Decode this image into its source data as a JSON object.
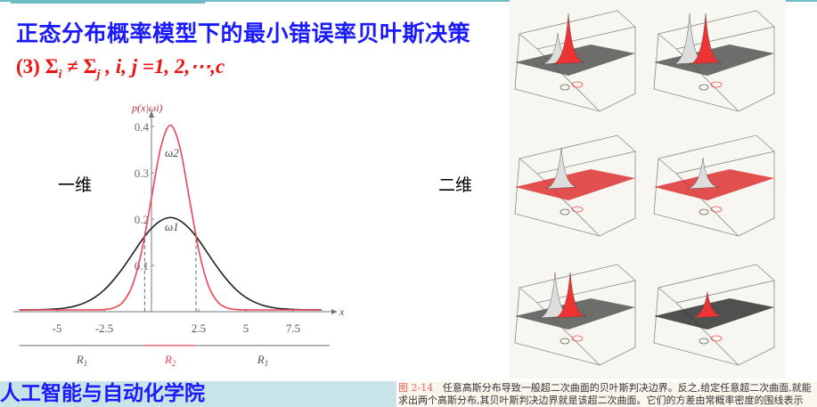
{
  "header": {
    "title": "正态分布概率模型下的最小错误率贝叶斯决策",
    "formula": {
      "prefix": "(3) Σ",
      "sub_i": "i",
      "neq": " ≠ Σ",
      "sub_j": "j",
      "rest": " ,   i, j =1, 2,⋯,c"
    }
  },
  "labels": {
    "one_dim": "一维",
    "two_dim": "二维"
  },
  "chart_data": {
    "type": "line",
    "ylabel": "p(x|ωi)",
    "xlabel": "x",
    "x_ticks": [
      "-5",
      "-2.5",
      "2.5",
      "5",
      "7.5"
    ],
    "x_tick_values": [
      -5,
      -2.5,
      2.5,
      5,
      7.5
    ],
    "y_ticks": [
      "0.1",
      "0.2",
      "0.3",
      "0.4"
    ],
    "y_tick_values": [
      0.1,
      0.2,
      0.3,
      0.4
    ],
    "xlim": [
      -7,
      9.5
    ],
    "ylim": [
      0,
      0.42
    ],
    "grid": false,
    "x": [
      -7,
      -6.5,
      -6,
      -5.5,
      -5,
      -4.5,
      -4,
      -3.5,
      -3,
      -2.5,
      -2,
      -1.5,
      -1,
      -0.5,
      0,
      0.5,
      1,
      1.5,
      2,
      2.5,
      3,
      3.5,
      4,
      4.5,
      5,
      5.5,
      6,
      6.5,
      7,
      7.5,
      8,
      8.5,
      9
    ],
    "series": [
      {
        "name": "ω1",
        "color": "#222222",
        "values": [
          0.0001,
          0.0002,
          0.0004,
          0.001,
          0.0022,
          0.0046,
          0.0088,
          0.016,
          0.027,
          0.0431,
          0.065,
          0.0914,
          0.121,
          0.151,
          0.176,
          0.193,
          0.1995,
          0.193,
          0.176,
          0.151,
          0.121,
          0.0914,
          0.065,
          0.0431,
          0.027,
          0.016,
          0.0088,
          0.0046,
          0.0022,
          0.001,
          0.0004,
          0.0002,
          0.0001
        ]
      },
      {
        "name": "ω2",
        "color": "#ee4455",
        "values": [
          0,
          0,
          0,
          0,
          0,
          0,
          0,
          0,
          0.0001,
          0.0009,
          0.0044,
          0.0175,
          0.054,
          0.13,
          0.242,
          0.352,
          0.399,
          0.352,
          0.242,
          0.13,
          0.054,
          0.0175,
          0.0044,
          0.0009,
          0.0001,
          0,
          0,
          0,
          0,
          0,
          0,
          0,
          0
        ]
      }
    ],
    "decision_boundaries": [
      -0.36,
      2.36
    ],
    "regions": [
      {
        "label": "R1",
        "sub": "1",
        "from": -7,
        "to": -0.36,
        "color": "#888888"
      },
      {
        "label": "R2",
        "sub": "2",
        "from": -0.36,
        "to": 2.36,
        "color": "#ee4455"
      },
      {
        "label": "R1",
        "sub": "1",
        "from": 2.36,
        "to": 9.5,
        "color": "#888888"
      }
    ]
  },
  "figure_caption": {
    "number": "图 2-14",
    "line1": "任意高斯分布导致一般超二次曲面的贝叶斯判决边界。反之,给定任意超二次曲面,就能",
    "line2": "求出两个高斯分布,其贝叶斯判决边界就是该超二次曲面。它们的方差由常概率密度的围线表示"
  },
  "footer": {
    "school": "人工智能与自动化学院"
  },
  "colors": {
    "title": "#1a1aff",
    "formula": "#ee1111",
    "footer_bg": "#c9e4e9",
    "accent_bar": "#6fbcc4"
  }
}
